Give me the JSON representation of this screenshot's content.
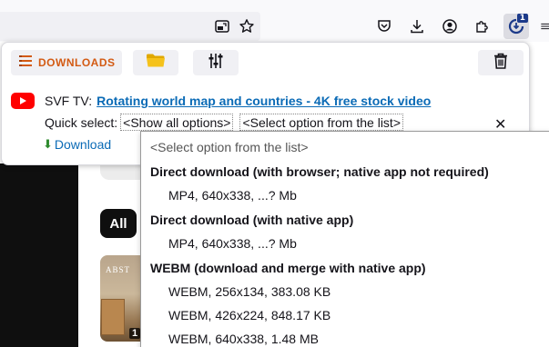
{
  "toolbar": {
    "icons": [
      "picture-in-picture-icon",
      "bookmark-star-icon",
      "pocket-icon",
      "download-arrow-icon",
      "account-icon",
      "extensions-puzzle-icon",
      "video-downloader-icon"
    ],
    "extension_badge": "1"
  },
  "panel": {
    "downloads_label": "DOWNLOADS",
    "source_label": "SVF TV:",
    "video_title": "Rotating world map and countries - 4K free stock video",
    "quick_select_label": "Quick select:",
    "quick_select_value": "<Show all options>",
    "option_select_value": "<Select option from the list>",
    "download_label": "Download"
  },
  "dropdown": {
    "options": [
      {
        "type": "placeholder",
        "label": "<Select option from the list>"
      },
      {
        "type": "group",
        "label": "Direct download (with browser; native app not required)"
      },
      {
        "type": "item",
        "label": "MP4, 640x338, ...? Mb"
      },
      {
        "type": "group",
        "label": "Direct download (with native app)"
      },
      {
        "type": "item",
        "label": "MP4, 640x338, ...? Mb"
      },
      {
        "type": "group",
        "label": "WEBM (download and merge with native app)"
      },
      {
        "type": "item",
        "label": "WEBM, 256x134, 383.08 KB"
      },
      {
        "type": "item",
        "label": "WEBM, 426x224, 848.17 KB"
      },
      {
        "type": "item",
        "label": "WEBM, 640x338, 1.48 MB"
      }
    ]
  },
  "page": {
    "chip_all": "All",
    "thumb_text": "ABST",
    "thumb_number": "1"
  },
  "colors": {
    "accent_orange": "#d35a13",
    "link_blue": "#0b6bb6",
    "youtube_red": "#ff0000",
    "download_green": "#2e8b2e",
    "badge_blue": "#1c3a8a"
  }
}
